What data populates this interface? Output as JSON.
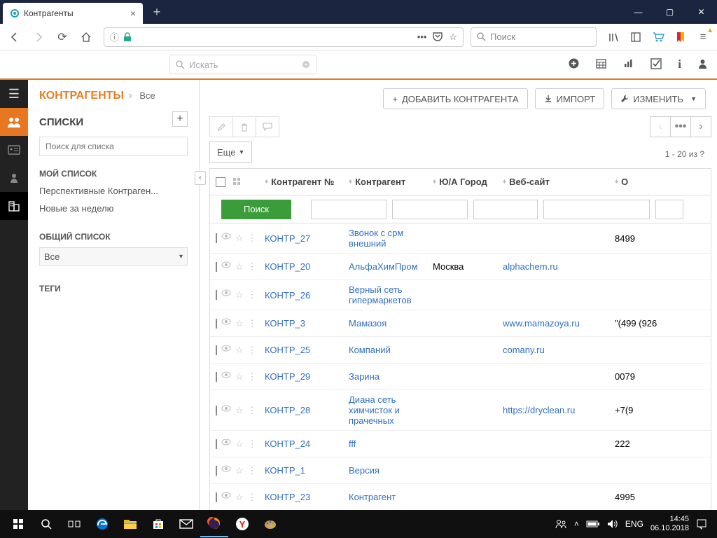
{
  "browser": {
    "tab_title": "Контрагенты",
    "search_placeholder": "Поиск"
  },
  "app": {
    "search_placeholder": "Искать"
  },
  "header": {
    "title": "КОНТРАГЕНТЫ",
    "breadcrumb": "Все",
    "btn_add": "ДОБАВИТЬ КОНТРАГЕНТА",
    "btn_import": "ИМПОРТ",
    "btn_edit": "ИЗМЕНИТЬ"
  },
  "lists": {
    "section": "СПИСКИ",
    "search_placeholder": "Поиск для списка",
    "my_list": "МОЙ СПИСОК",
    "items": [
      "Перспективные Контраген...",
      "Новые за неделю"
    ],
    "common": "ОБЩИЙ СПИСОК",
    "selected": "Все",
    "tags": "ТЕГИ"
  },
  "grid": {
    "more": "Еще",
    "range": "1 - 20  из  ?",
    "search_btn": "Поиск",
    "cols": {
      "num": "Контрагент №",
      "name": "Контрагент",
      "city": "Ю/А Город",
      "web": "Веб-сайт",
      "phone": "О"
    },
    "rows": [
      {
        "num": "КОНТР_27",
        "name": "Звонок с срм внешний",
        "city": "",
        "web": "",
        "phone": "8499"
      },
      {
        "num": "КОНТР_20",
        "name": "АльфаХимПром",
        "city": "Москва",
        "web": "alphachem.ru",
        "phone": ""
      },
      {
        "num": "КОНТР_26",
        "name": "Верный сеть гипермаркетов",
        "city": "",
        "web": "",
        "phone": ""
      },
      {
        "num": "КОНТР_3",
        "name": "Мамазоя",
        "city": "",
        "web": "www.mamazoya.ru",
        "phone": "\"(499 (926"
      },
      {
        "num": "КОНТР_25",
        "name": "Компаний",
        "city": "",
        "web": "comany.ru",
        "phone": ""
      },
      {
        "num": "КОНТР_29",
        "name": "Зарина",
        "city": "",
        "web": "",
        "phone": "0079"
      },
      {
        "num": "КОНТР_28",
        "name": "Диана сеть химчисток и прачечных",
        "city": "",
        "web": "https://dryclean.ru",
        "phone": "+7(9"
      },
      {
        "num": "КОНТР_24",
        "name": "fff",
        "city": "",
        "web": "",
        "phone": "222"
      },
      {
        "num": "КОНТР_1",
        "name": "Версия",
        "city": "",
        "web": "",
        "phone": ""
      },
      {
        "num": "КОНТР_23",
        "name": "Контрагент",
        "city": "",
        "web": "",
        "phone": "4995"
      }
    ]
  },
  "taskbar": {
    "lang": "ENG",
    "time": "14:45",
    "date": "06.10.2018"
  }
}
